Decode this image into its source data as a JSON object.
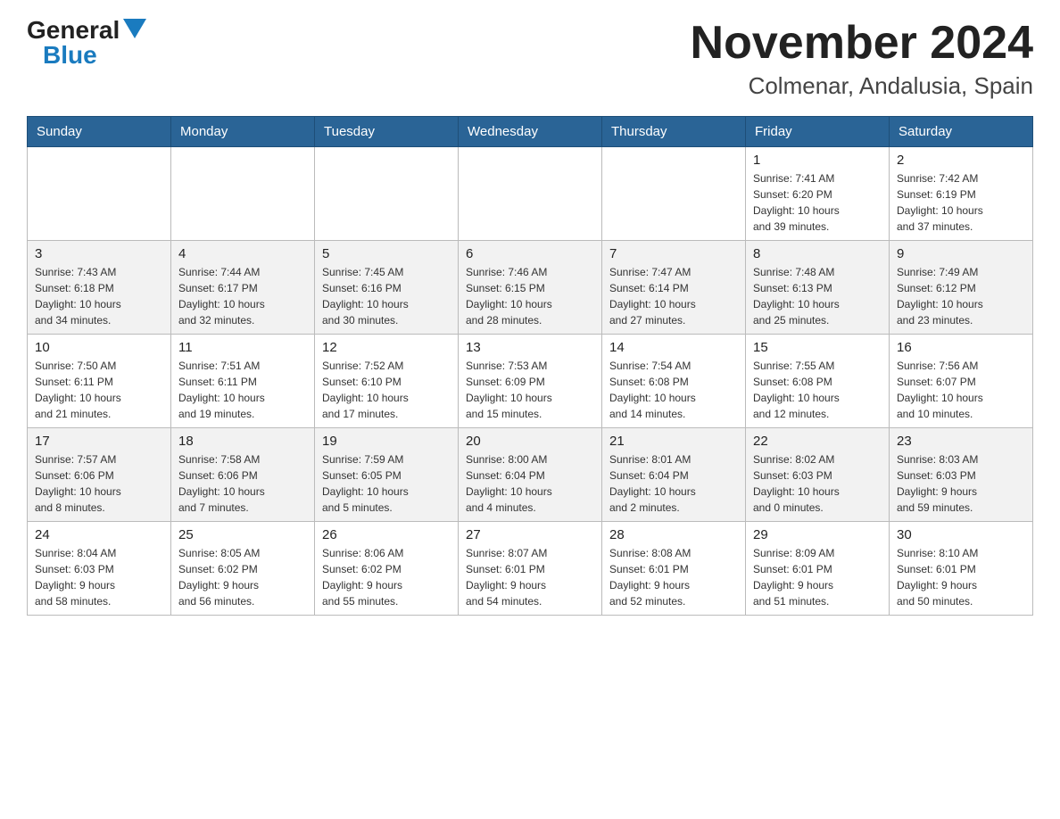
{
  "logo": {
    "general": "General",
    "blue": "Blue"
  },
  "title": "November 2024",
  "subtitle": "Colmenar, Andalusia, Spain",
  "days_of_week": [
    "Sunday",
    "Monday",
    "Tuesday",
    "Wednesday",
    "Thursday",
    "Friday",
    "Saturday"
  ],
  "weeks": [
    [
      {
        "day": "",
        "info": ""
      },
      {
        "day": "",
        "info": ""
      },
      {
        "day": "",
        "info": ""
      },
      {
        "day": "",
        "info": ""
      },
      {
        "day": "",
        "info": ""
      },
      {
        "day": "1",
        "info": "Sunrise: 7:41 AM\nSunset: 6:20 PM\nDaylight: 10 hours\nand 39 minutes."
      },
      {
        "day": "2",
        "info": "Sunrise: 7:42 AM\nSunset: 6:19 PM\nDaylight: 10 hours\nand 37 minutes."
      }
    ],
    [
      {
        "day": "3",
        "info": "Sunrise: 7:43 AM\nSunset: 6:18 PM\nDaylight: 10 hours\nand 34 minutes."
      },
      {
        "day": "4",
        "info": "Sunrise: 7:44 AM\nSunset: 6:17 PM\nDaylight: 10 hours\nand 32 minutes."
      },
      {
        "day": "5",
        "info": "Sunrise: 7:45 AM\nSunset: 6:16 PM\nDaylight: 10 hours\nand 30 minutes."
      },
      {
        "day": "6",
        "info": "Sunrise: 7:46 AM\nSunset: 6:15 PM\nDaylight: 10 hours\nand 28 minutes."
      },
      {
        "day": "7",
        "info": "Sunrise: 7:47 AM\nSunset: 6:14 PM\nDaylight: 10 hours\nand 27 minutes."
      },
      {
        "day": "8",
        "info": "Sunrise: 7:48 AM\nSunset: 6:13 PM\nDaylight: 10 hours\nand 25 minutes."
      },
      {
        "day": "9",
        "info": "Sunrise: 7:49 AM\nSunset: 6:12 PM\nDaylight: 10 hours\nand 23 minutes."
      }
    ],
    [
      {
        "day": "10",
        "info": "Sunrise: 7:50 AM\nSunset: 6:11 PM\nDaylight: 10 hours\nand 21 minutes."
      },
      {
        "day": "11",
        "info": "Sunrise: 7:51 AM\nSunset: 6:11 PM\nDaylight: 10 hours\nand 19 minutes."
      },
      {
        "day": "12",
        "info": "Sunrise: 7:52 AM\nSunset: 6:10 PM\nDaylight: 10 hours\nand 17 minutes."
      },
      {
        "day": "13",
        "info": "Sunrise: 7:53 AM\nSunset: 6:09 PM\nDaylight: 10 hours\nand 15 minutes."
      },
      {
        "day": "14",
        "info": "Sunrise: 7:54 AM\nSunset: 6:08 PM\nDaylight: 10 hours\nand 14 minutes."
      },
      {
        "day": "15",
        "info": "Sunrise: 7:55 AM\nSunset: 6:08 PM\nDaylight: 10 hours\nand 12 minutes."
      },
      {
        "day": "16",
        "info": "Sunrise: 7:56 AM\nSunset: 6:07 PM\nDaylight: 10 hours\nand 10 minutes."
      }
    ],
    [
      {
        "day": "17",
        "info": "Sunrise: 7:57 AM\nSunset: 6:06 PM\nDaylight: 10 hours\nand 8 minutes."
      },
      {
        "day": "18",
        "info": "Sunrise: 7:58 AM\nSunset: 6:06 PM\nDaylight: 10 hours\nand 7 minutes."
      },
      {
        "day": "19",
        "info": "Sunrise: 7:59 AM\nSunset: 6:05 PM\nDaylight: 10 hours\nand 5 minutes."
      },
      {
        "day": "20",
        "info": "Sunrise: 8:00 AM\nSunset: 6:04 PM\nDaylight: 10 hours\nand 4 minutes."
      },
      {
        "day": "21",
        "info": "Sunrise: 8:01 AM\nSunset: 6:04 PM\nDaylight: 10 hours\nand 2 minutes."
      },
      {
        "day": "22",
        "info": "Sunrise: 8:02 AM\nSunset: 6:03 PM\nDaylight: 10 hours\nand 0 minutes."
      },
      {
        "day": "23",
        "info": "Sunrise: 8:03 AM\nSunset: 6:03 PM\nDaylight: 9 hours\nand 59 minutes."
      }
    ],
    [
      {
        "day": "24",
        "info": "Sunrise: 8:04 AM\nSunset: 6:03 PM\nDaylight: 9 hours\nand 58 minutes."
      },
      {
        "day": "25",
        "info": "Sunrise: 8:05 AM\nSunset: 6:02 PM\nDaylight: 9 hours\nand 56 minutes."
      },
      {
        "day": "26",
        "info": "Sunrise: 8:06 AM\nSunset: 6:02 PM\nDaylight: 9 hours\nand 55 minutes."
      },
      {
        "day": "27",
        "info": "Sunrise: 8:07 AM\nSunset: 6:01 PM\nDaylight: 9 hours\nand 54 minutes."
      },
      {
        "day": "28",
        "info": "Sunrise: 8:08 AM\nSunset: 6:01 PM\nDaylight: 9 hours\nand 52 minutes."
      },
      {
        "day": "29",
        "info": "Sunrise: 8:09 AM\nSunset: 6:01 PM\nDaylight: 9 hours\nand 51 minutes."
      },
      {
        "day": "30",
        "info": "Sunrise: 8:10 AM\nSunset: 6:01 PM\nDaylight: 9 hours\nand 50 minutes."
      }
    ]
  ]
}
